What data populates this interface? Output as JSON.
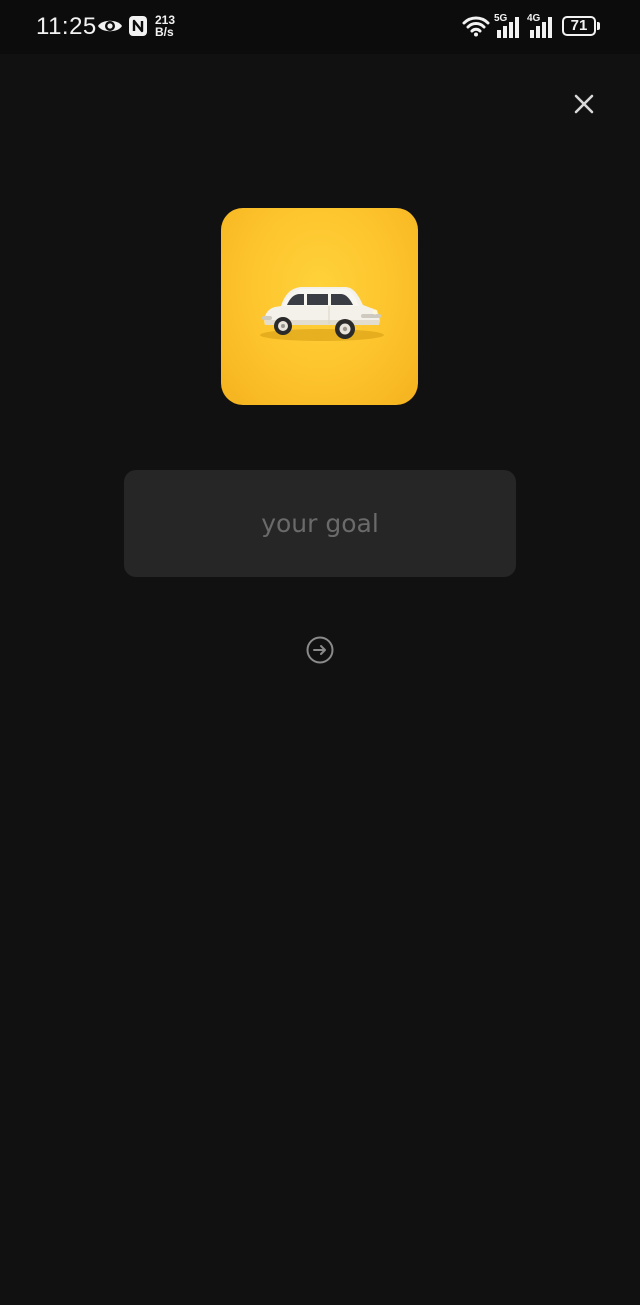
{
  "status_bar": {
    "time": "11:25",
    "net_speed_value": "213",
    "net_speed_unit": "B/s",
    "sim1_gen": "5G",
    "sim2_gen": "4G",
    "battery_level": "71",
    "icons": [
      "eye-icon",
      "nfc-icon",
      "wifi-icon",
      "signal-icon",
      "battery-icon"
    ]
  },
  "header": {
    "close_icon": "close-icon"
  },
  "goal_image": {
    "subject": "white toy car on yellow background",
    "background_color": "#fdc32c"
  },
  "goal_input": {
    "value": "",
    "placeholder": "your goal"
  },
  "actions": {
    "next_icon": "arrow-right-circle-icon"
  },
  "colors": {
    "background": "#111111",
    "input_background": "#262626",
    "placeholder": "#6a6a6a",
    "icon": "#d8d8d8",
    "muted_icon": "#8a8a8a"
  }
}
